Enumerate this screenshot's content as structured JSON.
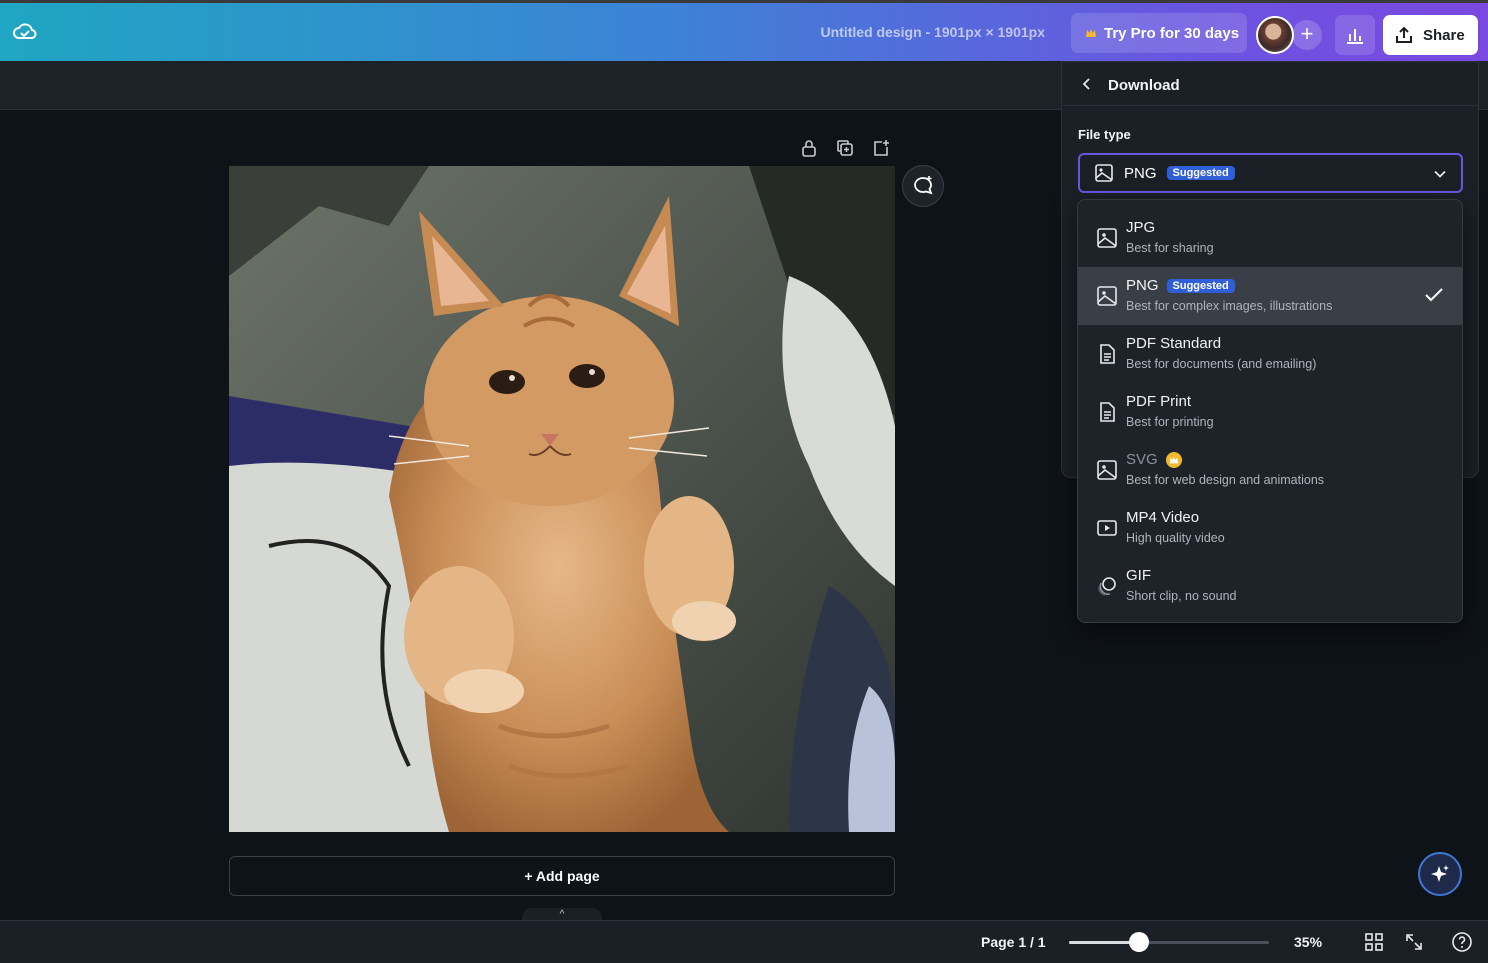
{
  "header": {
    "doc_title": "Untitled design - 1901px × 1901px",
    "pro_label": "Try Pro for 30 days",
    "share_label": "Share"
  },
  "canvas": {
    "add_page_label": "+ Add page"
  },
  "footer": {
    "page_indicator": "Page 1 / 1",
    "zoom_label": "35%",
    "zoom_fraction": 0.35
  },
  "download": {
    "title": "Download",
    "file_type_label": "File type",
    "selected": {
      "label": "PNG",
      "badge": "Suggested"
    },
    "options": [
      {
        "label": "JPG",
        "desc": "Best for sharing",
        "icon": "image-icon"
      },
      {
        "label": "PNG",
        "badge": "Suggested",
        "desc": "Best for complex images, illustrations",
        "icon": "image-icon",
        "selected": true
      },
      {
        "label": "PDF Standard",
        "desc": "Best for documents (and emailing)",
        "icon": "document-icon"
      },
      {
        "label": "PDF Print",
        "desc": "Best for printing",
        "icon": "document-icon"
      },
      {
        "label": "SVG",
        "desc": "Best for web design and animations",
        "icon": "image-icon",
        "pro": true
      },
      {
        "label": "MP4 Video",
        "desc": "High quality video",
        "icon": "video-icon"
      },
      {
        "label": "GIF",
        "desc": "Short clip, no sound",
        "icon": "gif-icon"
      }
    ]
  },
  "colors": {
    "accent": "#6a55e0",
    "badge": "#2f5fd6",
    "panel_bg": "#1b2027",
    "canvas_bg": "#0e1318"
  }
}
